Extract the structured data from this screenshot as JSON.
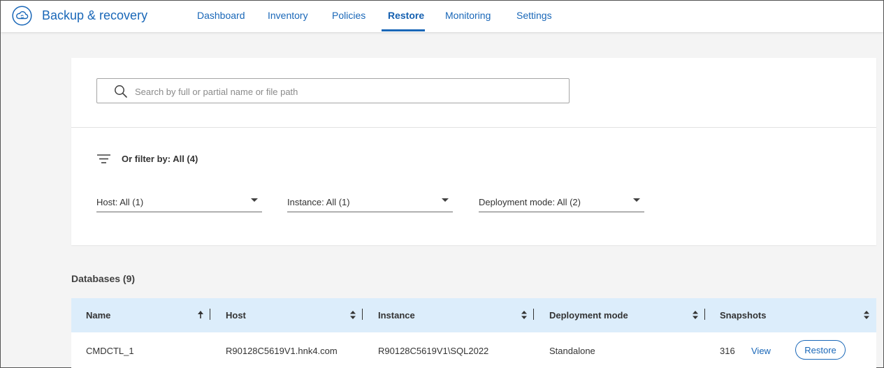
{
  "header": {
    "app_title": "Backup & recovery",
    "icon": "cloud-sync-icon",
    "tabs": [
      {
        "label": "Dashboard",
        "active": false
      },
      {
        "label": "Inventory",
        "active": false
      },
      {
        "label": "Policies",
        "active": false
      },
      {
        "label": "Restore",
        "active": true
      },
      {
        "label": "Monitoring",
        "active": false
      },
      {
        "label": "Settings",
        "active": false
      }
    ]
  },
  "search": {
    "placeholder": "Search by full or partial name or file path",
    "value": ""
  },
  "filters": {
    "label": "Or filter by: All (4)",
    "dropdowns": [
      {
        "label": "Host: All (1)"
      },
      {
        "label": "Instance: All (1)"
      },
      {
        "label": "Deployment mode: All (2)"
      }
    ]
  },
  "databases": {
    "title": "Databases (9)",
    "columns": [
      {
        "label": "Name",
        "sort": "ascending"
      },
      {
        "label": "Host",
        "sort": "none"
      },
      {
        "label": "Instance",
        "sort": "none"
      },
      {
        "label": "Deployment mode",
        "sort": "none"
      },
      {
        "label": "Snapshots",
        "sort": "none"
      }
    ],
    "rows": [
      {
        "name": "CMDCTL_1",
        "host": "R90128C5619V1.hnk4.com",
        "instance": "R90128C5619V1\\SQL2022",
        "deployment_mode": "Standalone",
        "snapshots": "316",
        "view_label": "View",
        "restore_label": "Restore"
      }
    ]
  },
  "colors": {
    "accent": "#1967b8",
    "header_row_bg": "#dcedfb",
    "page_bg": "#f4f4f4"
  }
}
